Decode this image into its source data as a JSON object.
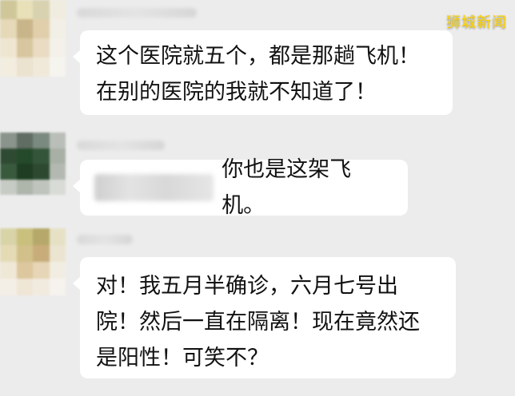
{
  "watermark": "狮城新闻",
  "messages": [
    {
      "lines": [
        "这个医院就五个，都是那趟飞机！",
        "在别的医院的我就不知道了！"
      ]
    },
    {
      "text": "你也是这架飞机。"
    },
    {
      "lines": [
        "对！我五月半确诊，六月七号出",
        "院！然后一直在隔离！现在竟然还",
        "是阳性！可笑不？"
      ]
    }
  ],
  "colors": {
    "background": "#ececec",
    "bubble": "#ffffff",
    "watermark": "#ffd400"
  }
}
